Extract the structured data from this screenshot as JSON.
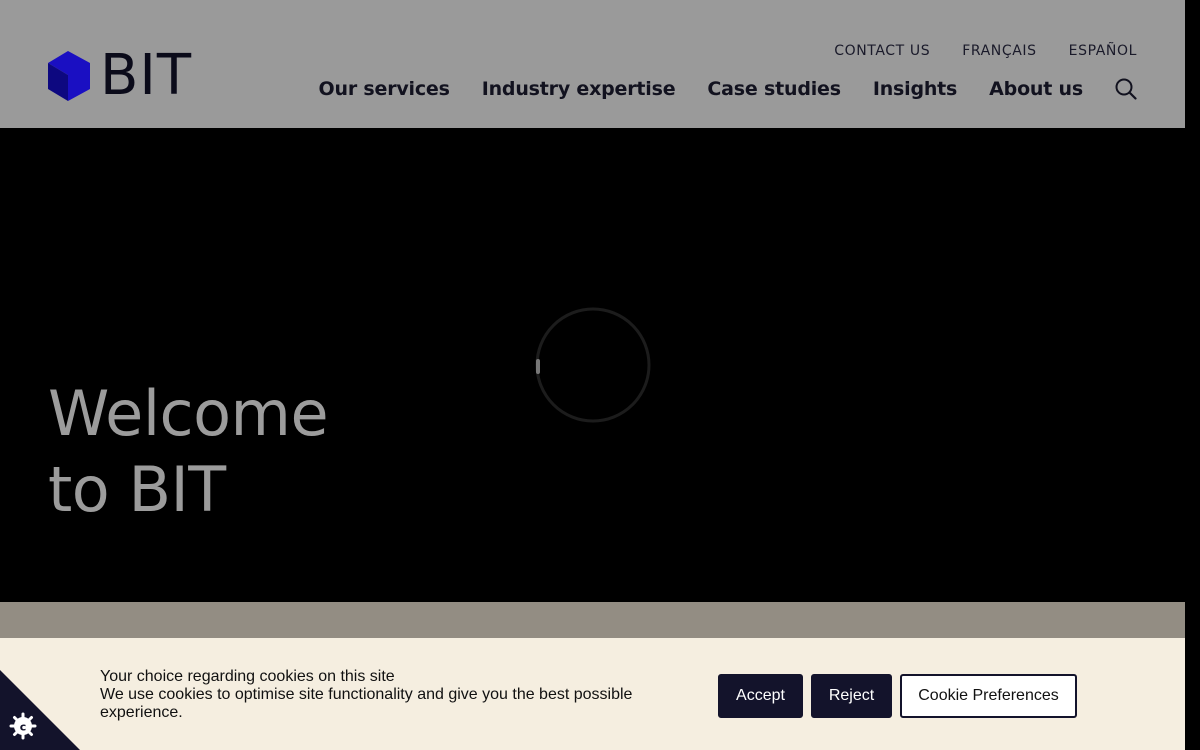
{
  "header": {
    "logo_text": "BIT",
    "utility_nav": [
      "CONTACT US",
      "FRANÇAIS",
      "ESPAÑOL"
    ],
    "main_nav": [
      "Our services",
      "Industry expertise",
      "Case studies",
      "Insights",
      "About us"
    ],
    "search_icon": "search-icon",
    "brand_color": "#1a0fc2"
  },
  "hero": {
    "title_line1": "Welcome",
    "title_line2": "to BIT",
    "loading_icon": "spinner-icon"
  },
  "cookie_banner": {
    "title": "Your choice regarding cookies on this site",
    "body": "We use cookies to optimise site functionality and give you the best possible experience.",
    "accept_label": "Accept",
    "reject_label": "Reject",
    "preferences_label": "Cookie Preferences",
    "corner_icon": "cookie-icon"
  }
}
